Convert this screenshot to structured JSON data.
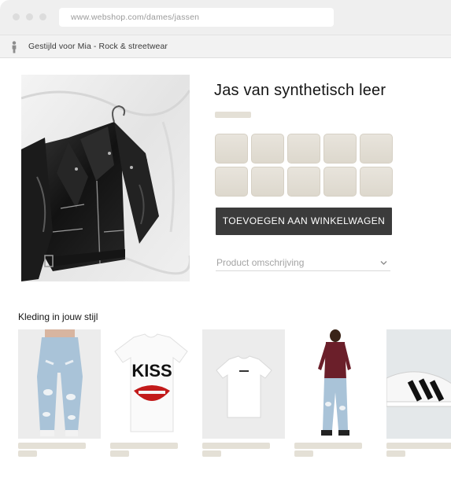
{
  "browser": {
    "url": "www.webshop.com/dames/jassen",
    "bookmark": "Gestijld voor Mia - Rock & streetwear"
  },
  "product": {
    "title": "Jas van synthetisch leer",
    "image": "black-leather-biker-jacket",
    "size_option_count": 10,
    "add_to_cart_label": "TOEVOEGEN AAN WINKELWAGEN",
    "description_label": "Product omschrijving"
  },
  "recommendations": {
    "title": "Kleding in jouw stijl",
    "items": [
      {
        "image": "ripped-light-jeans"
      },
      {
        "image": "kiss-band-tshirt"
      },
      {
        "image": "white-plain-tshirt"
      },
      {
        "image": "burgundy-top-with-ripped-jeans"
      },
      {
        "image": "white-sneaker-black-stripes"
      }
    ]
  },
  "colors": {
    "button": "#3b3b3b",
    "placeholder": "#e4e0d6",
    "size_box": "#e2ddd3"
  }
}
